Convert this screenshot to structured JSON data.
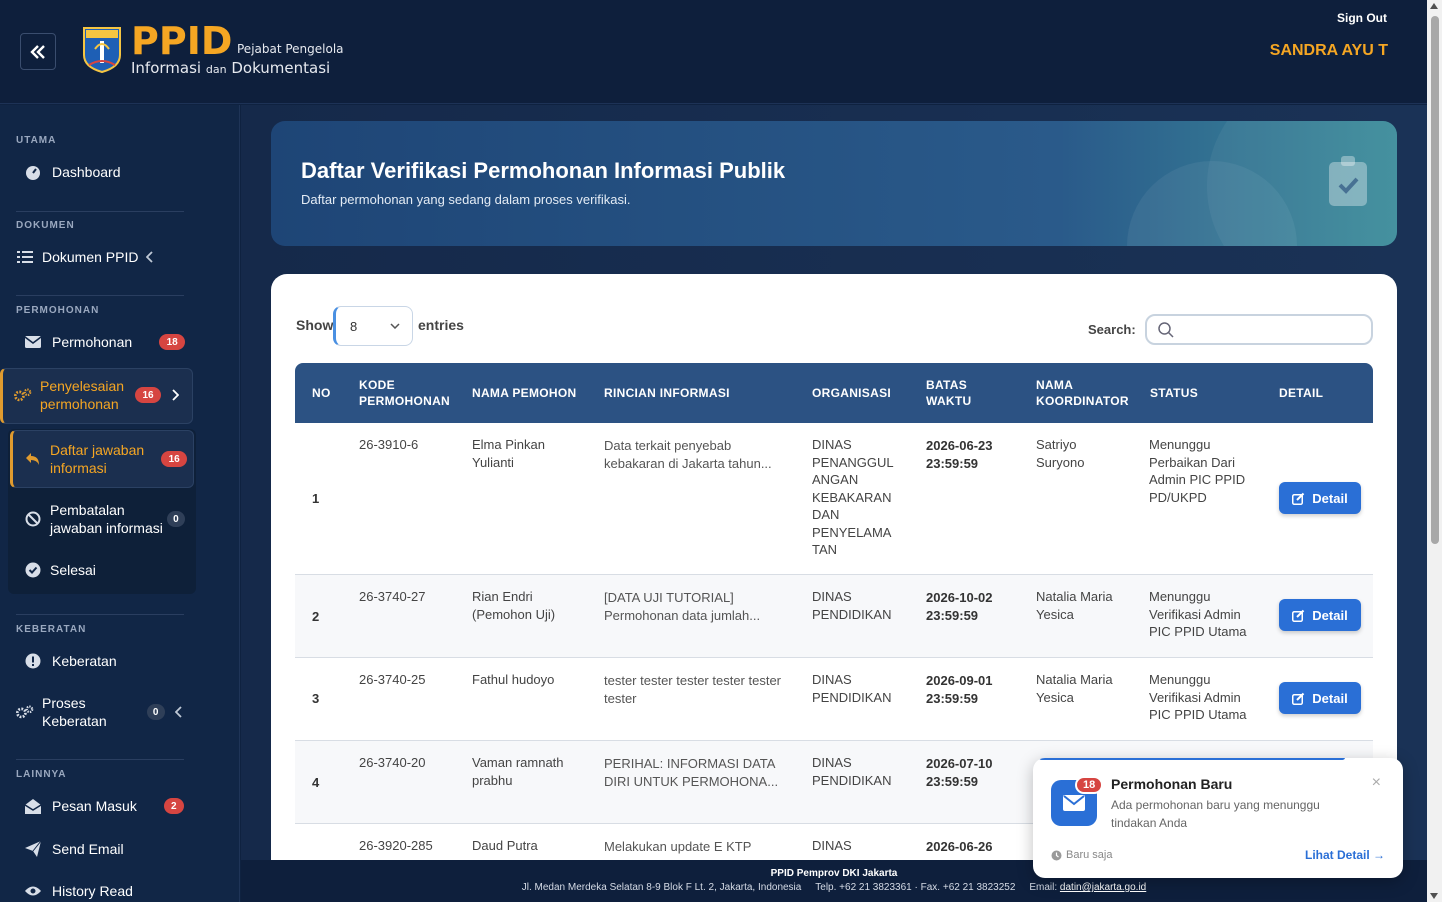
{
  "header": {
    "logo_main": "PPID",
    "logo_sub1": "Pejabat Pengelola",
    "logo_sub2a": "Informasi",
    "logo_sub2b": "dan",
    "logo_sub2c": "Dokumentasi",
    "signout": "Sign Out",
    "username": "SANDRA AYU T"
  },
  "sidebar": {
    "sections": {
      "utama": "UTAMA",
      "dokumen": "DOKUMEN",
      "permohonan": "PERMOHONAN",
      "keberatan": "KEBERATAN",
      "lainnya": "LAINNYA"
    },
    "items": {
      "dashboard": "Dashboard",
      "dokumen_ppid": "Dokumen PPID",
      "permohonan": "Permohonan",
      "permohonan_badge": "18",
      "penyelesaian_1": "Penyelesaian",
      "penyelesaian_2": "permohonan",
      "penyelesaian_badge": "16",
      "daftar_1": "Daftar jawaban",
      "daftar_2": "informasi",
      "daftar_badge": "16",
      "pembatalan_1": "Pembatalan",
      "pembatalan_2": "jawaban informasi",
      "pembatalan_badge": "0",
      "selesai": "Selesai",
      "keberatan": "Keberatan",
      "proses_1": "Proses",
      "proses_2": "Keberatan",
      "proses_badge": "0",
      "pesan_masuk": "Pesan Masuk",
      "pesan_badge": "2",
      "send_email": "Send Email",
      "history_read": "History Read"
    }
  },
  "banner": {
    "title": "Daftar Verifikasi Permohonan Informasi Publik",
    "subtitle": "Daftar permohonan yang sedang dalam proses verifikasi."
  },
  "table_controls": {
    "show": "Show",
    "entries_value": "8",
    "entries": "entries",
    "search": "Search:"
  },
  "table": {
    "headers": {
      "no": "NO",
      "kode_1": "KODE",
      "kode_2": "PERMOHONAN",
      "nama": "NAMA PEMOHON",
      "rincian": "RINCIAN INFORMASI",
      "organisasi": "ORGANISASI",
      "batas_1": "BATAS",
      "batas_2": "WAKTU",
      "koord_1": "NAMA",
      "koord_2": "KOORDINATOR",
      "status": "STATUS",
      "detail": "DETAIL"
    },
    "detail_label": "Detail",
    "rows": [
      {
        "no": "1",
        "kode": "26-3910-6",
        "nama_1": "Elma Pinkan",
        "nama_2": "Yulianti",
        "rincian_1": "Data terkait penyebab",
        "rincian_2": "kebakaran di Jakarta tahun...",
        "org_1": "DINAS",
        "org_2": "PENANGGUL",
        "org_3": "ANGAN",
        "org_4": "KEBAKARAN",
        "org_5": "DAN",
        "org_6": "PENYELAMA",
        "org_7": "TAN",
        "batas_1": "2026-06-23",
        "batas_2": "23:59:59",
        "koord_1": "Satriyo",
        "koord_2": "Suryono",
        "status_1": "Menunggu",
        "status_2": "Perbaikan Dari",
        "status_3": "Admin PIC PPID",
        "status_4": "PD/UKPD"
      },
      {
        "no": "2",
        "kode": "26-3740-27",
        "nama_1": "Rian Endri",
        "nama_2": "(Pemohon Uji)",
        "rincian_1": "[DATA UJI TUTORIAL]",
        "rincian_2": "Permohonan data jumlah...",
        "org_1": "DINAS",
        "org_2": "PENDIDIKAN",
        "batas_1": "2026-10-02",
        "batas_2": "23:59:59",
        "koord_1": "Natalia Maria",
        "koord_2": "Yesica",
        "status_1": "Menunggu",
        "status_2": "Verifikasi Admin",
        "status_3": "PIC PPID Utama"
      },
      {
        "no": "3",
        "kode": "26-3740-25",
        "nama_1": "Fathul hudoyo",
        "rincian_1": "tester tester tester tester tester",
        "rincian_2": "tester",
        "org_1": "DINAS",
        "org_2": "PENDIDIKAN",
        "batas_1": "2026-09-01",
        "batas_2": "23:59:59",
        "koord_1": "Natalia Maria",
        "koord_2": "Yesica",
        "status_1": "Menunggu",
        "status_2": "Verifikasi Admin",
        "status_3": "PIC PPID Utama"
      },
      {
        "no": "4",
        "kode": "26-3740-20",
        "nama_1": "Vaman ramnath",
        "nama_2": "prabhu",
        "rincian_1": "PERIHAL: INFORMASI DATA",
        "rincian_2": "DIRI UNTUK PERMOHONA...",
        "org_1": "DINAS",
        "org_2": "PENDIDIKAN",
        "batas_1": "2026-07-10",
        "batas_2": "23:59:59"
      },
      {
        "kode": "26-3920-285",
        "nama_1": "Daud Putra",
        "rincian_1": "Melakukan update E KTP",
        "org_1": "DINAS",
        "batas_1": "2026-06-26"
      }
    ]
  },
  "footer": {
    "line1": "PPID Pemprov DKI Jakarta",
    "address": "Jl. Medan Merdeka Selatan 8-9 Blok F Lt. 2, Jakarta, Indonesia",
    "phone": "Telp. +62 21 3823361 · Fax. +62 21 3823252",
    "email_label": "Email:",
    "email": "datin@jakarta.go.id"
  },
  "toast": {
    "badge": "18",
    "title": "Permohonan Baru",
    "message": "Ada permohonan baru yang menunggu tindakan Anda",
    "time": "Baru saja",
    "link": "Lihat Detail →"
  },
  "colors": {
    "accent": "#f5a623",
    "primary": "#2a6fd6",
    "header_bg": "#0e1f3c",
    "table_head": "#2c5283",
    "badge_red": "#d64541"
  }
}
